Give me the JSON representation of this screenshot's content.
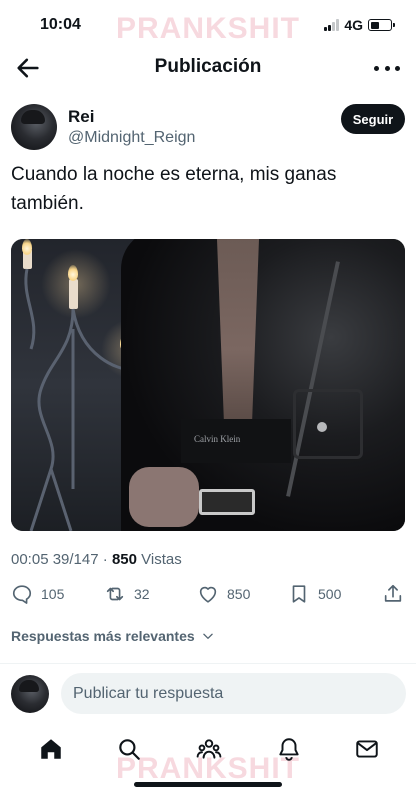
{
  "status_bar": {
    "time": "10:04",
    "network": "4G",
    "signal_bars_filled": 2,
    "signal_bars_total": 4
  },
  "watermark": "PRANKSHIT",
  "header": {
    "title": "Publicación"
  },
  "post": {
    "author_name": "Rei",
    "author_handle": "@Midnight_Reign",
    "follow_label": "Seguir",
    "text_line1": "Cuando la noche es eterna, mis ganas",
    "text_line2": "también.",
    "image_text": "Calvin Klein",
    "timestamp": "00:05 39/147",
    "separator": "·",
    "views_count": "850",
    "views_label": "Vistas"
  },
  "actions": {
    "replies": "105",
    "reposts": "32",
    "likes": "850",
    "bookmarks": "500"
  },
  "replies": {
    "sort_label": "Respuestas más relevantes",
    "reply_placeholder": "Publicar tu respuesta"
  },
  "colors": {
    "text": "#0f1419",
    "secondary": "#536471",
    "watermark": "#f7d9df"
  }
}
